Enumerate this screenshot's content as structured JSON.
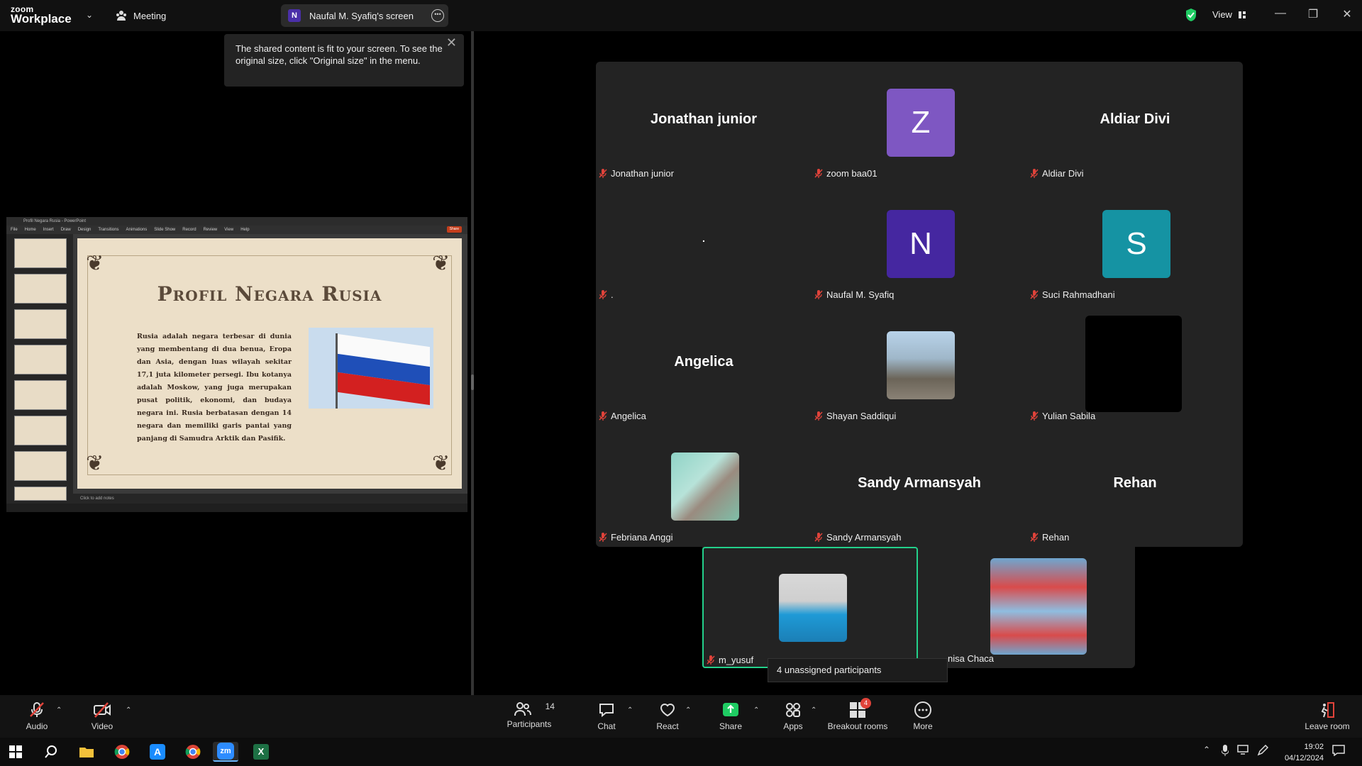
{
  "app": {
    "logo_top": "zoom",
    "logo_bottom": "Workplace",
    "meeting_label": "Meeting",
    "screen_share_label": "Naufal M. Syafiq's screen",
    "screen_share_initial": "N",
    "view_label": "View"
  },
  "tooltip": {
    "text": "The shared content is fit to your screen. To see the original size, click \"Original size\" in the menu."
  },
  "slide": {
    "title": "Profil Negara Rusia",
    "body": "Rusia adalah negara terbesar di dunia yang membentang di dua benua, Eropa dan Asia, dengan luas wilayah sekitar 17,1 juta kilometer persegi. Ibu kotanya adalah Moskow, yang juga merupakan pusat politik, ekonomi, dan budaya negara ini. Rusia berbatasan dengan 14 negara dan memiliki garis pantai yang panjang di Samudra Arktik dan Pasifik.",
    "notes": "Click to add notes",
    "ribbon_tabs": [
      "File",
      "Home",
      "Insert",
      "Draw",
      "Design",
      "Transitions",
      "Animations",
      "Slide Show",
      "Record",
      "Review",
      "View",
      "Help"
    ],
    "share_label": "Share",
    "window_title": "Profil Negara Rusia - PowerPoint"
  },
  "participants": [
    {
      "name": "Jonathan junior",
      "display": "Jonathan junior",
      "type": "text"
    },
    {
      "name": "zoom baa01",
      "display": "Z",
      "type": "avatar",
      "color": "#7e57c2"
    },
    {
      "name": "Aldiar Divi",
      "display": "Aldiar Divi",
      "type": "text"
    },
    {
      "name": ".",
      "display": ".",
      "type": "text"
    },
    {
      "name": "Naufal M. Syafiq",
      "display": "N",
      "type": "avatar",
      "color": "#4527a0"
    },
    {
      "name": "Suci Rahmadhani",
      "display": "S",
      "type": "avatar",
      "color": "#1593a3"
    },
    {
      "name": "Angelica",
      "display": "Angelica",
      "type": "text"
    },
    {
      "name": "Shayan Saddiqui",
      "display": "",
      "type": "photo"
    },
    {
      "name": "Yulian Sabila",
      "display": "",
      "type": "black"
    },
    {
      "name": "Febriana Anggi",
      "display": "",
      "type": "photo"
    },
    {
      "name": "Sandy Armansyah",
      "display": "Sandy Armansyah",
      "type": "text"
    },
    {
      "name": "Rehan",
      "display": "Rehan",
      "type": "text"
    },
    {
      "name": "m_yusuf",
      "display": "",
      "type": "photo"
    },
    {
      "name": "nisa Chaca",
      "display": "",
      "type": "photo"
    }
  ],
  "unassigned": "4 unassigned participants",
  "toolbar": {
    "audio": "Audio",
    "video": "Video",
    "participants": "Participants",
    "participants_count": "14",
    "chat": "Chat",
    "react": "React",
    "share": "Share",
    "apps": "Apps",
    "breakout": "Breakout rooms",
    "breakout_badge": "4",
    "more": "More",
    "leave": "Leave room"
  },
  "taskbar": {
    "time": "19:02",
    "date": "04/12/2024"
  },
  "colors": {
    "active_speaker": "#23d18b",
    "mic_muted": "#e0433a",
    "share_green": "#1fcc63"
  }
}
